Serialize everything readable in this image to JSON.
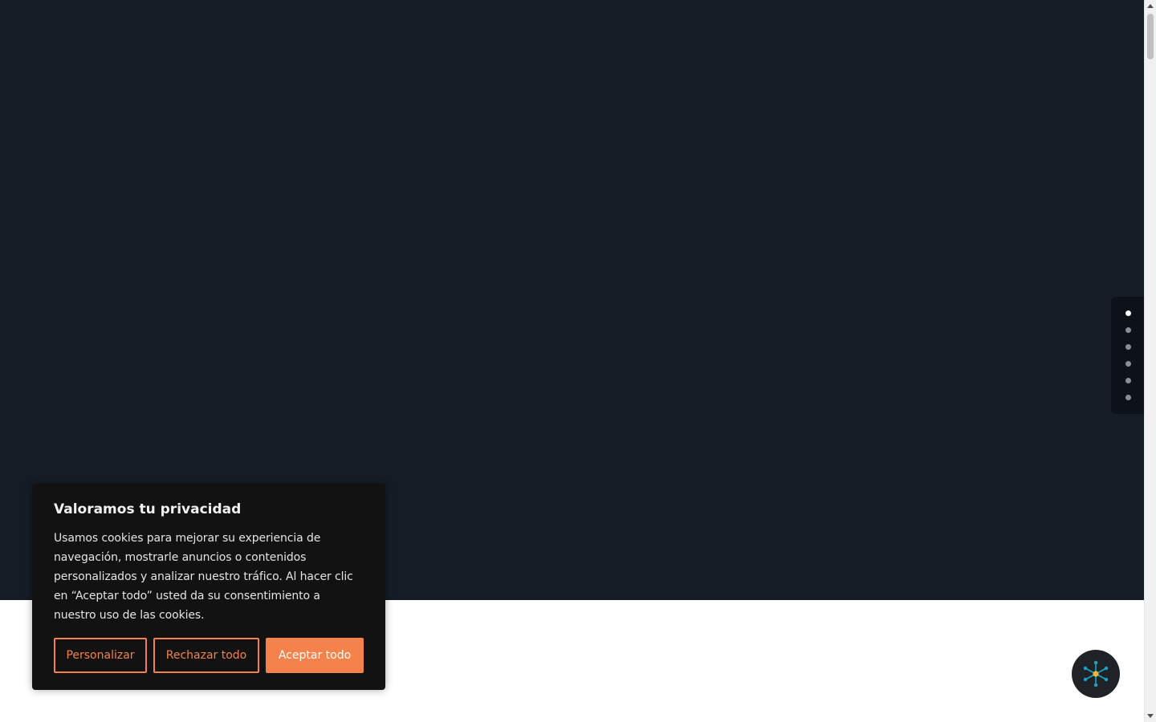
{
  "cookie_banner": {
    "title": "Valoramos tu privacidad",
    "body": "Usamos cookies para mejorar su experiencia de navegación, mostrarle anuncios o contenidos personalizados y analizar nuestro tráfico. Al hacer clic en “Aceptar todo” usted da su consentimiento a nuestro uso de las cookies.",
    "buttons": {
      "customize": "Personalizar",
      "reject": "Rechazar todo",
      "accept": "Aceptar todo"
    }
  },
  "side_nav": {
    "dots": 6,
    "active_index": 0
  },
  "floating_widget": {
    "icon": "network-hub-icon"
  },
  "colors": {
    "hero_background": "#141c25",
    "accent": "#f5814b",
    "banner_background": "#121212",
    "widget_background": "#1f2328",
    "widget_icon_primary": "#1aa5c6",
    "widget_icon_center": "#f2b43a"
  }
}
